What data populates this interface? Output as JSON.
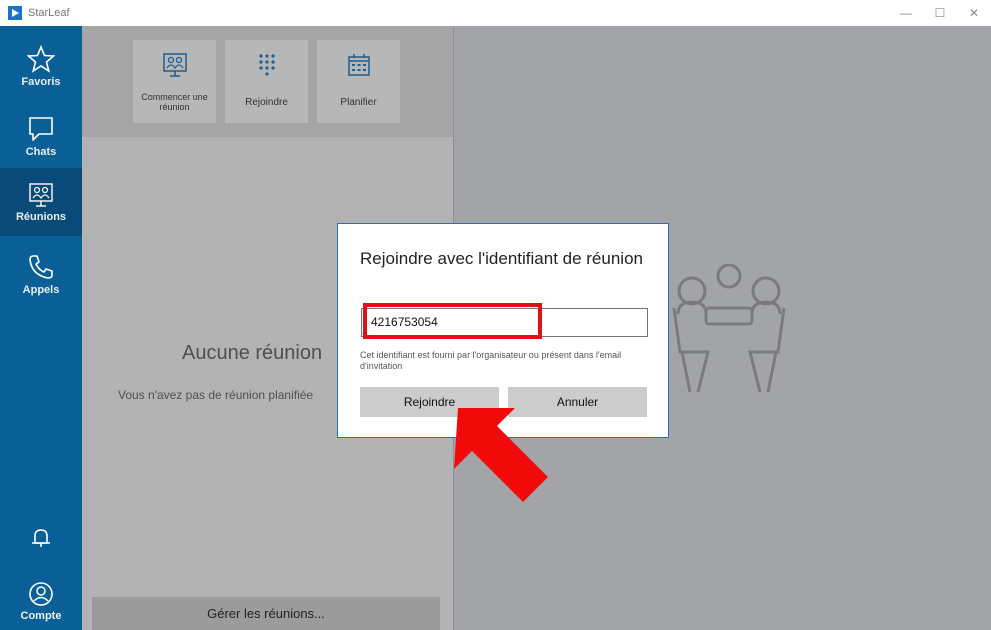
{
  "window": {
    "title": "StarLeaf",
    "minimize": "—",
    "maximize": "☐",
    "close": "✕"
  },
  "sidebar": {
    "items": [
      {
        "label": "Favoris",
        "icon": "star-icon"
      },
      {
        "label": "Chats",
        "icon": "chat-bubble-icon"
      },
      {
        "label": "Réunions",
        "icon": "meeting-icon",
        "active": true
      },
      {
        "label": "Appels",
        "icon": "phone-icon"
      }
    ],
    "bell_icon": "bell-icon",
    "account": {
      "label": "Compte",
      "icon": "account-icon"
    }
  },
  "toolbar": {
    "start_meeting": "Commencer une réunion",
    "join": "Rejoindre",
    "schedule": "Planifier"
  },
  "main": {
    "empty_title": "Aucune réunion",
    "empty_subtitle": "Vous n'avez pas de réunion planifiée",
    "manage_button": "Gérer les réunions..."
  },
  "dialog": {
    "title": "Rejoindre avec l'identifiant de réunion",
    "meeting_id_value": "4216753054",
    "hint": "Cet identifiant est fourni par l'organisateur ou présent dans l'email d'invitation",
    "join_button": "Rejoindre",
    "cancel_button": "Annuler"
  },
  "colors": {
    "sidebar": "#0a5f96",
    "sidebar_active": "#0a4a78",
    "highlight": "#e01016",
    "dialog_border": "#2a6fb5"
  }
}
